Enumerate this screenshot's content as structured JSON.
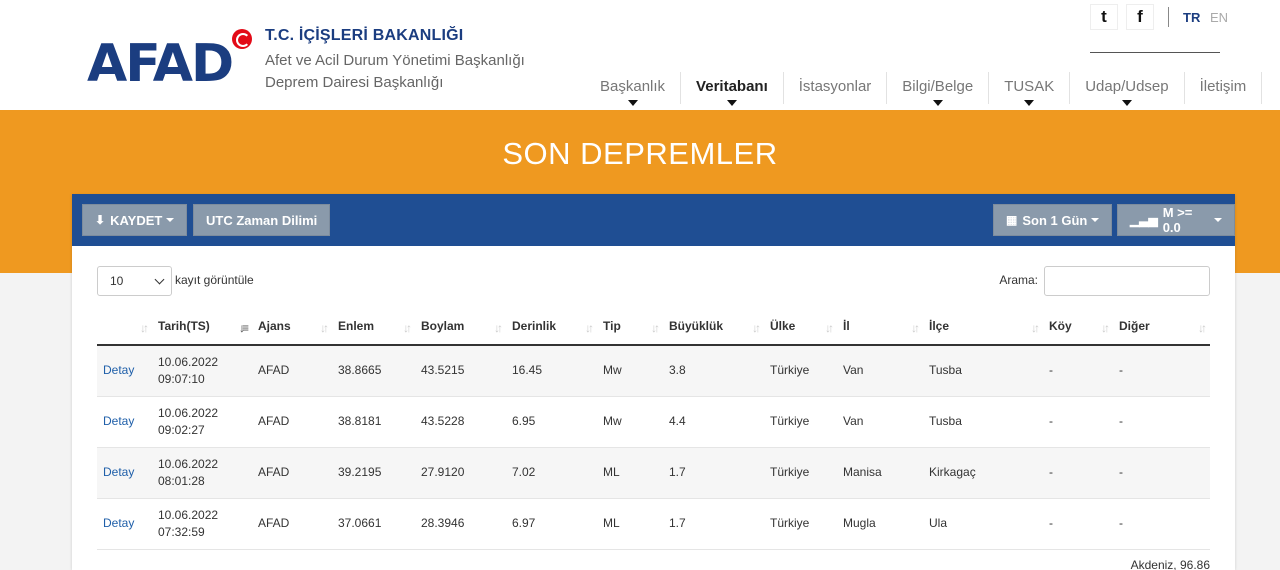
{
  "header": {
    "logo_text": "AFAD",
    "org_title": "T.C. İÇİŞLERİ BAKANLIĞI",
    "org_line1": "Afet ve Acil Durum Yönetimi Başkanlığı",
    "org_line2": "Deprem Dairesi Başkanlığı",
    "lang_tr": "TR",
    "lang_en": "EN",
    "social": [
      {
        "icon": "twitter-icon",
        "glyph": "t"
      },
      {
        "icon": "facebook-icon",
        "glyph": "f"
      }
    ],
    "nav": [
      {
        "label": "Başkanlık",
        "dropdown": true,
        "active": false
      },
      {
        "label": "Veritabanı",
        "dropdown": true,
        "active": true
      },
      {
        "label": "İstasyonlar",
        "dropdown": false,
        "active": false
      },
      {
        "label": "Bilgi/Belge",
        "dropdown": true,
        "active": false
      },
      {
        "label": "TUSAK",
        "dropdown": true,
        "active": false
      },
      {
        "label": "Udap/Udsep",
        "dropdown": true,
        "active": false
      },
      {
        "label": "İletişim",
        "dropdown": false,
        "active": false
      }
    ]
  },
  "band": {
    "title": "SON DEPREMLER"
  },
  "toolbar": {
    "save_label": "KAYDET",
    "utc_label": "UTC Zaman Dilimi",
    "range_label": "Son 1 Gün",
    "magnitude_label": "M >= 0.0"
  },
  "controls": {
    "page_size": "10",
    "page_size_label": "kayıt görüntüle",
    "search_label": "Arama:",
    "search_value": ""
  },
  "table": {
    "columns": [
      "",
      "Tarih(TS)",
      "Ajans",
      "Enlem",
      "Boylam",
      "Derinlik",
      "Tip",
      "Büyüklük",
      "Ülke",
      "İl",
      "İlçe",
      "Köy",
      "Diğer"
    ],
    "rows": [
      [
        "Detay",
        "10.06.2022",
        "09:07:10",
        "AFAD",
        "38.8665",
        "43.5215",
        "16.45",
        "Mw",
        "3.8",
        "Türkiye",
        "Van",
        "Tusba",
        "-",
        "-"
      ],
      [
        "Detay",
        "10.06.2022",
        "09:02:27",
        "AFAD",
        "38.8181",
        "43.5228",
        "6.95",
        "Mw",
        "4.4",
        "Türkiye",
        "Van",
        "Tusba",
        "-",
        "-"
      ],
      [
        "Detay",
        "10.06.2022",
        "08:01:28",
        "AFAD",
        "39.2195",
        "27.9120",
        "7.02",
        "ML",
        "1.7",
        "Türkiye",
        "Manisa",
        "Kirkagaç",
        "-",
        "-"
      ],
      [
        "Detay",
        "10.06.2022",
        "07:32:59",
        "AFAD",
        "37.0661",
        "28.3946",
        "6.97",
        "ML",
        "1.7",
        "Türkiye",
        "Mugla",
        "Ula",
        "-",
        "-"
      ]
    ],
    "partial_row_text": "Akdeniz, 96.86"
  },
  "colors": {
    "brand_blue": "#1b3d80",
    "toolbar_blue": "#1f4e93",
    "band_orange": "#ef9920",
    "button_gray": "#8a9aab"
  }
}
